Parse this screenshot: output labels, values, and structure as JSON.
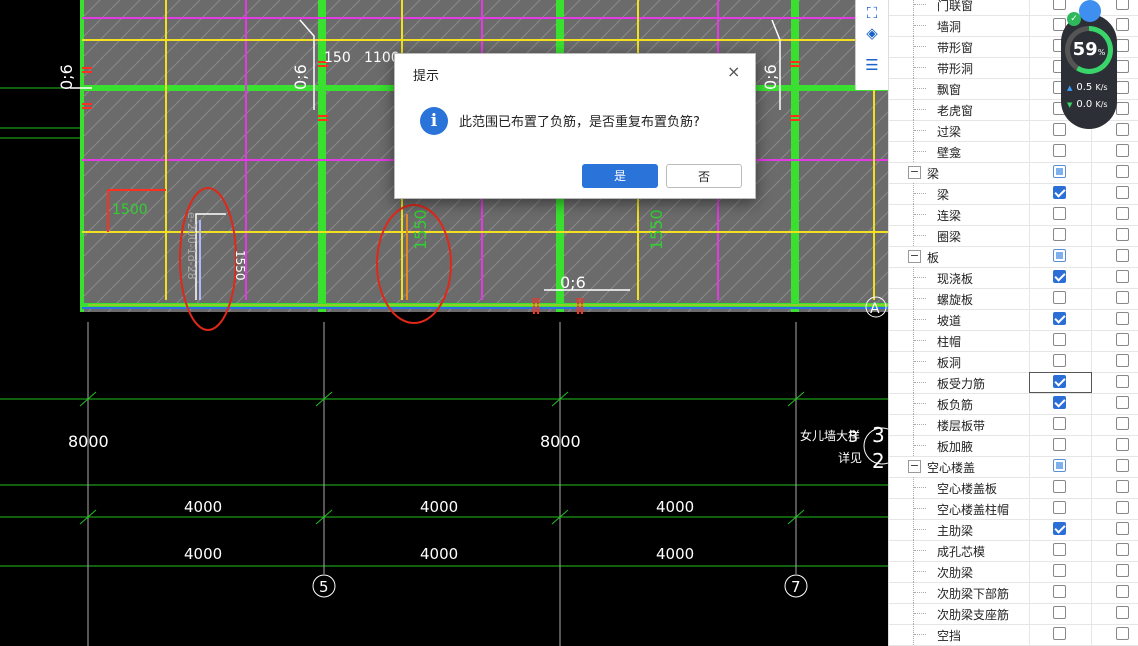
{
  "dialog": {
    "title": "提示",
    "close": "×",
    "info_glyph": "i",
    "message": "此范围已布置了负筋，是否重复布置负筋?",
    "yes_label": "是",
    "no_label": "否"
  },
  "widget": {
    "percent": "59",
    "percent_unit": "%",
    "up_speed": "0.5",
    "down_speed": "0.0",
    "speed_unit": "K/s",
    "up_arrow": "▲",
    "down_arrow": "▼",
    "check": "✓"
  },
  "toolbar_icons": [
    "crop-icon",
    "cube-icon",
    "list-view-icon"
  ],
  "tree": [
    {
      "label": "门联窗",
      "level": 1,
      "c1": "off",
      "c2": "off"
    },
    {
      "label": "墙洞",
      "level": 1,
      "c1": "off",
      "c2": "off"
    },
    {
      "label": "带形窗",
      "level": 1,
      "c1": "off",
      "c2": "off"
    },
    {
      "label": "带形洞",
      "level": 1,
      "c1": "off",
      "c2": "off"
    },
    {
      "label": "飘窗",
      "level": 1,
      "c1": "off",
      "c2": "off"
    },
    {
      "label": "老虎窗",
      "level": 1,
      "c1": "off",
      "c2": "off"
    },
    {
      "label": "过梁",
      "level": 1,
      "c1": "off",
      "c2": "off"
    },
    {
      "label": "壁龛",
      "level": 1,
      "c1": "off",
      "c2": "off"
    },
    {
      "label": "梁",
      "level": 0,
      "expander": "−",
      "c1": "part",
      "c2": "off"
    },
    {
      "label": "梁",
      "level": 1,
      "c1": "on",
      "c2": "off"
    },
    {
      "label": "连梁",
      "level": 1,
      "c1": "off",
      "c2": "off"
    },
    {
      "label": "圈梁",
      "level": 1,
      "c1": "off",
      "c2": "off"
    },
    {
      "label": "板",
      "level": 0,
      "expander": "−",
      "c1": "part",
      "c2": "off"
    },
    {
      "label": "现浇板",
      "level": 1,
      "c1": "on",
      "c2": "off"
    },
    {
      "label": "螺旋板",
      "level": 1,
      "c1": "off",
      "c2": "off"
    },
    {
      "label": "坡道",
      "level": 1,
      "c1": "on",
      "c2": "off"
    },
    {
      "label": "柱帽",
      "level": 1,
      "c1": "off",
      "c2": "off"
    },
    {
      "label": "板洞",
      "level": 1,
      "c1": "off",
      "c2": "off"
    },
    {
      "label": "板受力筋",
      "level": 1,
      "c1": "on",
      "c2": "off",
      "focus": true
    },
    {
      "label": "板负筋",
      "level": 1,
      "c1": "on",
      "c2": "off"
    },
    {
      "label": "楼层板带",
      "level": 1,
      "c1": "off",
      "c2": "off"
    },
    {
      "label": "板加腋",
      "level": 1,
      "c1": "off",
      "c2": "off"
    },
    {
      "label": "空心楼盖",
      "level": 0,
      "expander": "−",
      "c1": "part",
      "c2": "off"
    },
    {
      "label": "空心楼盖板",
      "level": 1,
      "c1": "off",
      "c2": "off"
    },
    {
      "label": "空心楼盖柱帽",
      "level": 1,
      "c1": "off",
      "c2": "off"
    },
    {
      "label": "主肋梁",
      "level": 1,
      "c1": "on",
      "c2": "off"
    },
    {
      "label": "成孔芯模",
      "level": 1,
      "c1": "off",
      "c2": "off"
    },
    {
      "label": "次肋梁",
      "level": 1,
      "c1": "off",
      "c2": "off"
    },
    {
      "label": "次肋梁下部筋",
      "level": 1,
      "c1": "off",
      "c2": "off"
    },
    {
      "label": "次肋梁支座筋",
      "level": 1,
      "c1": "off",
      "c2": "off"
    },
    {
      "label": "空挡",
      "level": 1,
      "c1": "off",
      "c2": "off"
    }
  ],
  "cad": {
    "dims_8000": [
      "8000",
      "8000"
    ],
    "dims_4000_row1": [
      "4000",
      "4000",
      "4000"
    ],
    "dims_4000_row2": [
      "4000",
      "4000",
      "4000"
    ],
    "axis_labels": [
      "5",
      "7",
      "A"
    ],
    "rebar_labels": [
      "0;6",
      "0;6",
      "0;6",
      "0;6"
    ],
    "len_labels": [
      "1500",
      "1550",
      "1550",
      "1550"
    ],
    "top_dims": [
      "150",
      "1100"
    ],
    "left_rebar_text": "e-200-1d-28",
    "note_line1": "女儿墙大样",
    "note_line2": "详见",
    "note_num1": "3",
    "note_num2": "3",
    "note_num3": "2"
  }
}
